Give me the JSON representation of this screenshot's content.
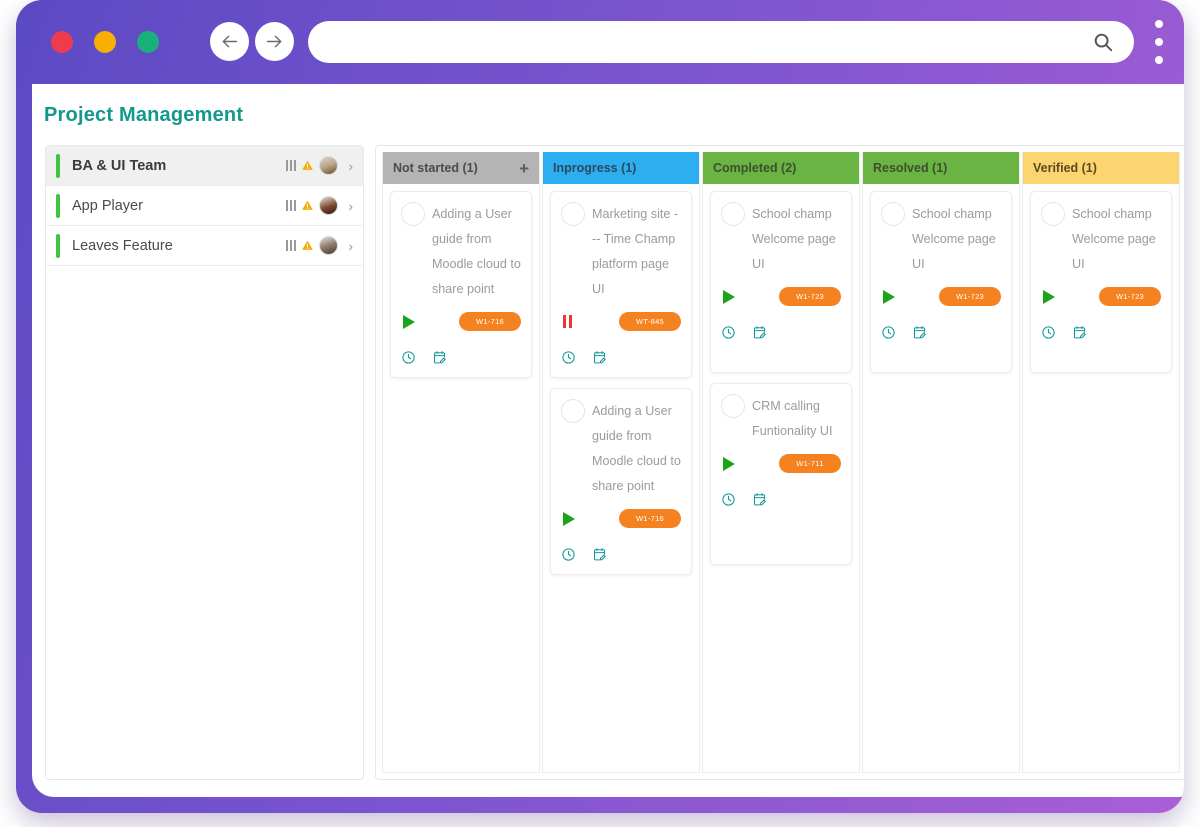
{
  "browser": {
    "traffic_lights": [
      "close",
      "minimize",
      "maximize"
    ],
    "back_label": "Back",
    "forward_label": "Forward",
    "address_value": "",
    "address_placeholder": "",
    "search_icon": "search-icon",
    "menu_icon": "kebab-menu-icon",
    "colors": {
      "chrome_start": "#5b4ac4",
      "chrome_end": "#a95fd6"
    }
  },
  "page": {
    "title": "Project Management",
    "title_color": "#12998c"
  },
  "sidebar": {
    "items": [
      {
        "label": "BA & UI Team",
        "active": true,
        "accent": "#3fc53f",
        "avatar": "a1"
      },
      {
        "label": "App Player",
        "active": false,
        "accent": "#3fc53f",
        "avatar": "a2"
      },
      {
        "label": "Leaves Feature",
        "active": false,
        "accent": "#3fc53f",
        "avatar": "a3"
      }
    ],
    "row_icons": [
      "bars-icon",
      "warning-icon",
      "avatar",
      "chevron-right-icon"
    ]
  },
  "board": {
    "columns": [
      {
        "label": "Not started (1)",
        "color": "#b4b4b4",
        "text_color": "#4b4b4b",
        "has_add": true,
        "add_label": "+",
        "cards": [
          {
            "title": "Adding a User guide from Moodle cloud to share point",
            "avatar": "a1",
            "state": "play",
            "badge": "W1-716",
            "icons": [
              "clock-icon",
              "calendar-edit-icon"
            ]
          }
        ]
      },
      {
        "label": "Inprogress (1)",
        "color": "#2caef0",
        "text_color": "#2b4a5c",
        "has_add": false,
        "add_label": "",
        "cards": [
          {
            "title": "Marketing site --- Time Champ platform page UI",
            "avatar": "a4",
            "state": "pause",
            "badge": "WT-845",
            "icons": [
              "clock-icon",
              "calendar-edit-icon"
            ]
          },
          {
            "title": "Adding a User guide from Moodle cloud to share point",
            "avatar": "a1",
            "state": "play",
            "badge": "W1-716",
            "icons": [
              "clock-icon",
              "calendar-edit-icon"
            ]
          }
        ]
      },
      {
        "label": "Completed (2)",
        "color": "#6ab443",
        "text_color": "#3d4f2e",
        "has_add": false,
        "add_label": "",
        "cards": [
          {
            "title": "School champ Welcome page UI",
            "avatar": "a4",
            "state": "play",
            "badge": "W1-723",
            "icons": [
              "clock-icon",
              "calendar-edit-icon"
            ]
          },
          {
            "title": "CRM calling Funtionality UI",
            "avatar": "a2",
            "state": "play",
            "badge": "W1-711",
            "icons": [
              "clock-icon",
              "calendar-edit-icon"
            ]
          }
        ]
      },
      {
        "label": "Resolved (1)",
        "color": "#6ab443",
        "text_color": "#3d4f2e",
        "has_add": false,
        "add_label": "",
        "cards": [
          {
            "title": "School champ Welcome page UI",
            "avatar": "a4",
            "state": "play",
            "badge": "W1-723",
            "icons": [
              "clock-icon",
              "calendar-edit-icon"
            ]
          }
        ]
      },
      {
        "label": "Verified (1)",
        "color": "#fcd571",
        "text_color": "#5b4a20",
        "has_add": false,
        "add_label": "",
        "cards": [
          {
            "title": "School champ Welcome page UI",
            "avatar": "a4",
            "state": "play",
            "badge": "W1-723",
            "icons": [
              "clock-icon",
              "calendar-edit-icon"
            ]
          }
        ]
      }
    ]
  }
}
